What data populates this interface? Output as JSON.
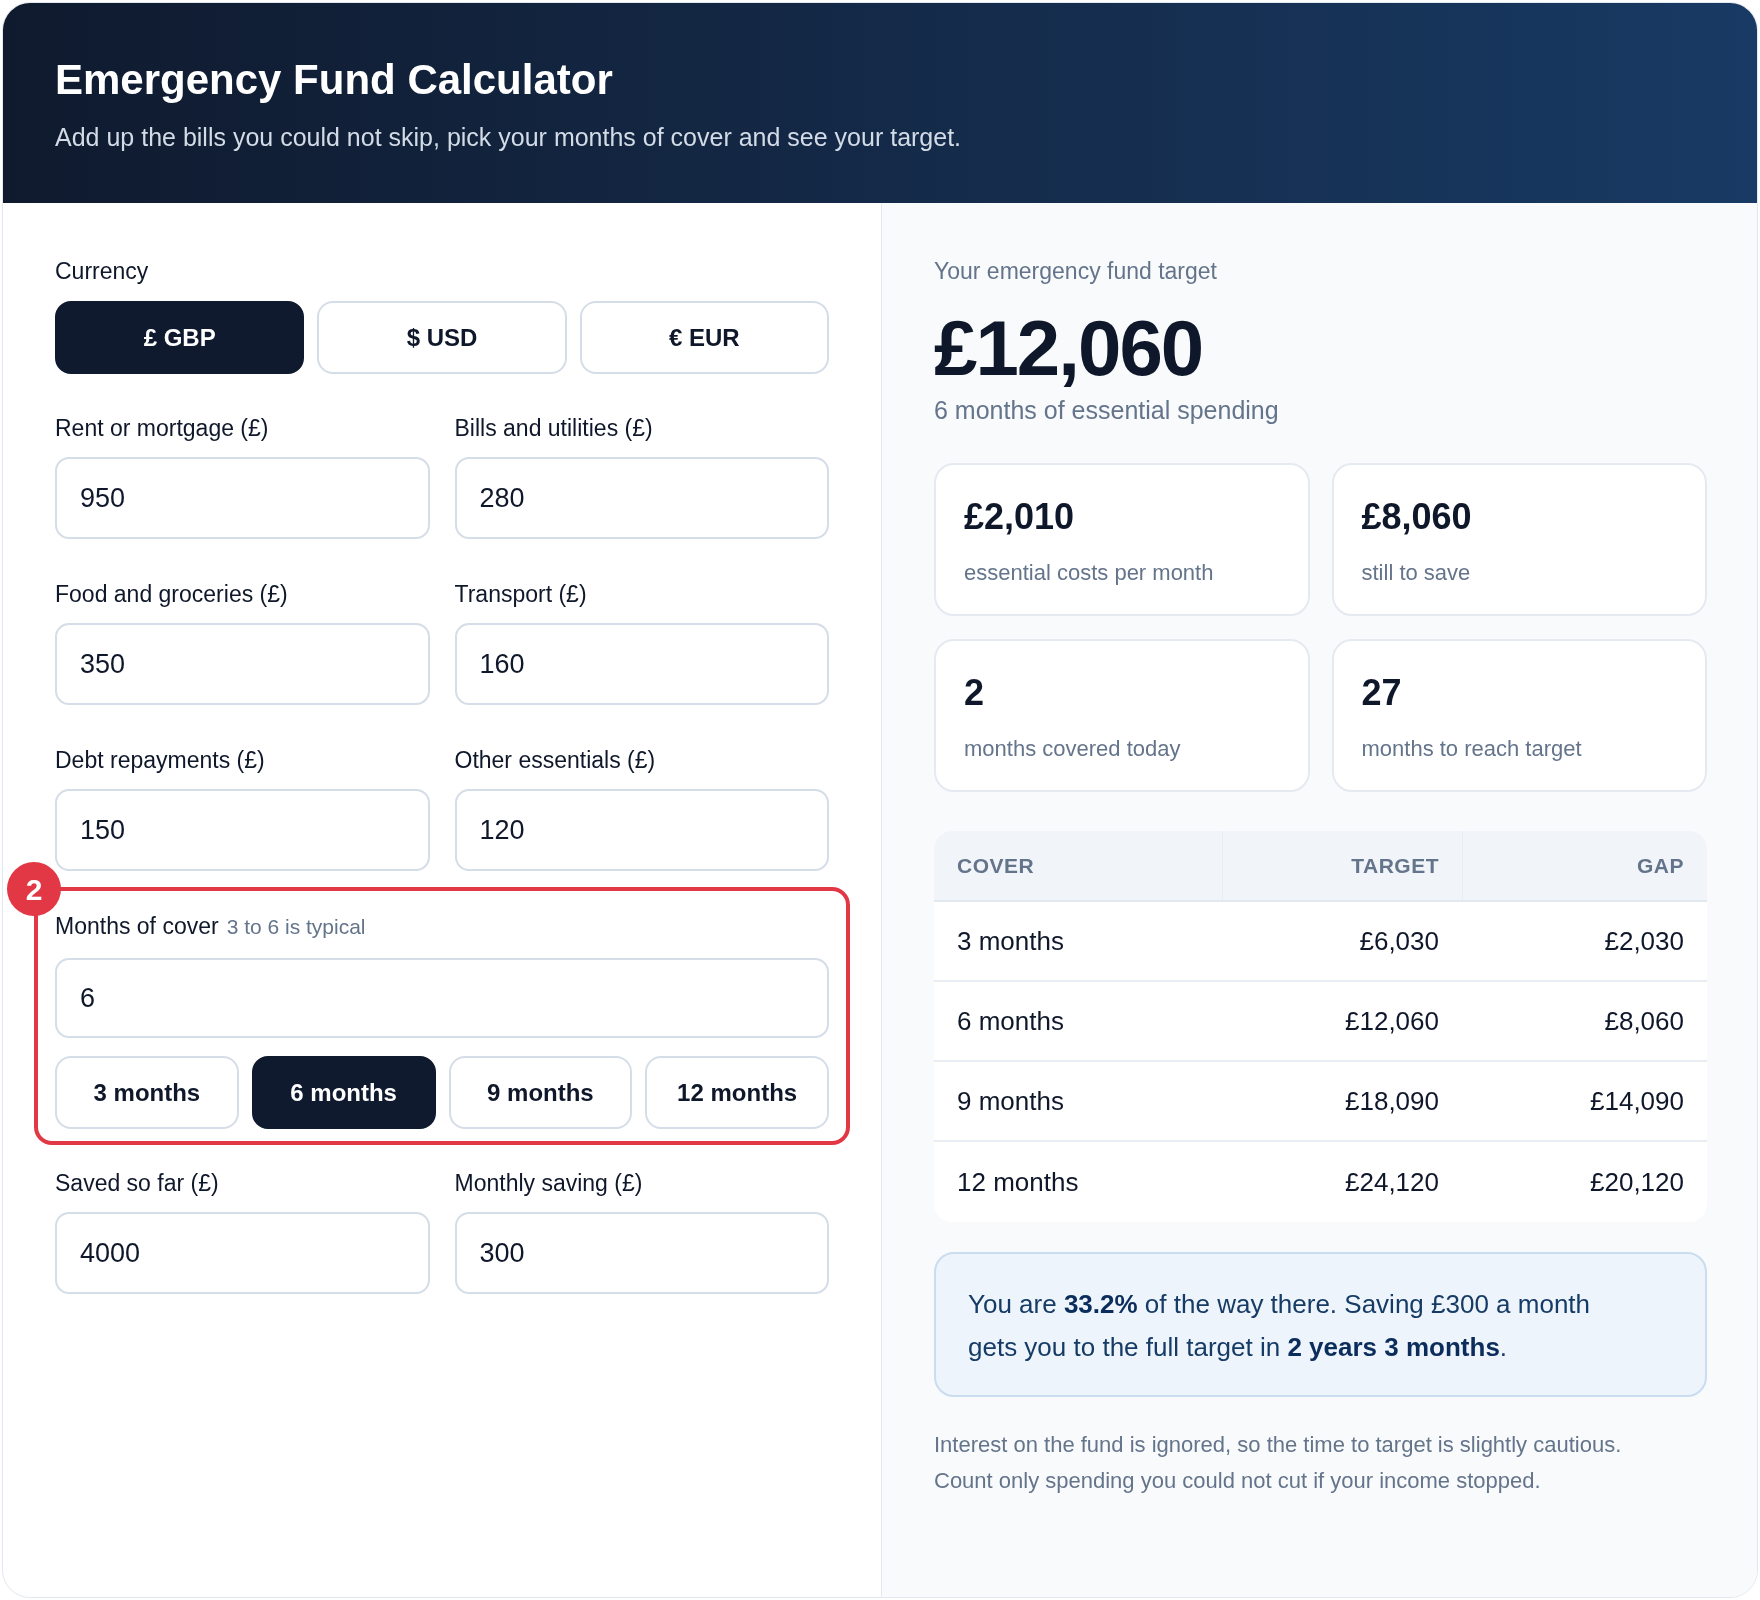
{
  "header": {
    "title": "Emergency Fund Calculator",
    "subtitle": "Add up the bills you could not skip, pick your months of cover and see your target."
  },
  "form": {
    "currency": {
      "label": "Currency",
      "options": [
        {
          "label": "£ GBP",
          "selected": true
        },
        {
          "label": "$ USD",
          "selected": false
        },
        {
          "label": "€ EUR",
          "selected": false
        }
      ]
    },
    "expense_fields": [
      {
        "label": "Rent or mortgage (£)",
        "value": "950"
      },
      {
        "label": "Bills and utilities (£)",
        "value": "280"
      },
      {
        "label": "Food and groceries (£)",
        "value": "350"
      },
      {
        "label": "Transport (£)",
        "value": "160"
      },
      {
        "label": "Debt repayments (£)",
        "value": "150"
      },
      {
        "label": "Other essentials (£)",
        "value": "120"
      }
    ],
    "months_of_cover": {
      "label": "Months of cover",
      "hint": "3 to 6 is typical",
      "value": "6",
      "presets": [
        {
          "label": "3 months",
          "selected": false
        },
        {
          "label": "6 months",
          "selected": true
        },
        {
          "label": "9 months",
          "selected": false
        },
        {
          "label": "12 months",
          "selected": false
        }
      ],
      "annotation": {
        "badge": "2"
      }
    },
    "savings_fields": [
      {
        "label": "Saved so far (£)",
        "value": "4000"
      },
      {
        "label": "Monthly saving (£)",
        "value": "300"
      }
    ]
  },
  "results": {
    "heading": "Your emergency fund target",
    "target": "£12,060",
    "caption": "6 months of essential spending",
    "stats": [
      {
        "value": "£2,010",
        "label": "essential costs per month"
      },
      {
        "value": "£8,060",
        "label": "still to save"
      },
      {
        "value": "2",
        "label": "months covered today"
      },
      {
        "value": "27",
        "label": "months to reach target"
      }
    ],
    "table": {
      "columns": [
        "COVER",
        "TARGET",
        "GAP"
      ],
      "rows": [
        [
          "3 months",
          "£6,030",
          "£2,030"
        ],
        [
          "6 months",
          "£12,060",
          "£8,060"
        ],
        [
          "9 months",
          "£18,090",
          "£14,090"
        ],
        [
          "12 months",
          "£24,120",
          "£20,120"
        ]
      ]
    },
    "summary": "You are **33.2%** of the way there. Saving £300 a month gets you to the full target in **2 years 3 months**.",
    "note": "Interest on the fund is ignored, so the time to target is slightly cautious. Count only spending you could not cut if your income stopped."
  }
}
